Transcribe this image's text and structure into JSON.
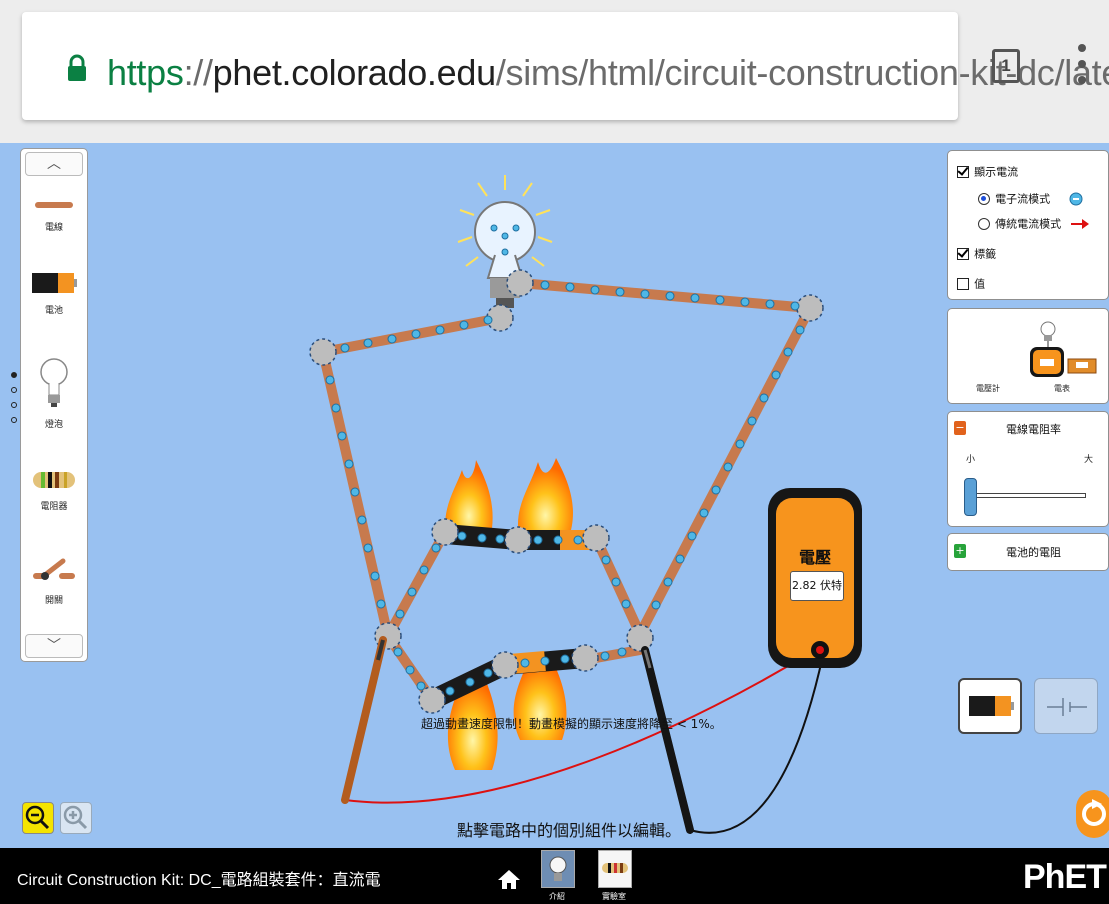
{
  "browser": {
    "url_scheme": "https",
    "url_sep": "://",
    "url_host": "phet.colorado.edu",
    "url_path": "/sims/html/circuit-construction-kit-dc/latest",
    "tab_count": "1"
  },
  "toolbox": {
    "items": [
      {
        "label": "電線",
        "icon": "wire-icon"
      },
      {
        "label": "電池",
        "icon": "battery-icon"
      },
      {
        "label": "燈泡",
        "icon": "lightbulb-icon"
      },
      {
        "label": "電阻器",
        "icon": "resistor-icon"
      },
      {
        "label": "開關",
        "icon": "switch-icon"
      }
    ]
  },
  "display_panel": {
    "show_current": "顯示電流",
    "electrons": "電子流模式",
    "conventional": "傳統電流模式",
    "labels": "標籤",
    "values": "值",
    "show_current_checked": true,
    "electrons_selected": true,
    "labels_checked": true,
    "values_checked": false
  },
  "tools_panel": {
    "voltmeter": "電壓計",
    "ammeter": "電表"
  },
  "wire_resistivity": {
    "title": "電線電阻率",
    "min": "小",
    "max": "大",
    "level": 0.0
  },
  "battery_resistance": {
    "title": "電池的電阻"
  },
  "voltmeter": {
    "title": "電壓",
    "reading": "2.82 伏特"
  },
  "messages": {
    "speed_warning": "超過動畫速度限制！動畫模擬的顯示速度將降至 < 1%。",
    "hint": "點擊電路中的個別組件以編輯。"
  },
  "footer": {
    "title": "Circuit Construction Kit: DC_電路組裝套件：直流電",
    "screens": [
      {
        "label": "介紹"
      },
      {
        "label": "實驗室"
      }
    ],
    "brand": "PhET"
  },
  "colors": {
    "electron": "#4fb7e6",
    "wire": "#c77a4e",
    "meter_orange": "#f7941d",
    "url_green": "#0b8043"
  }
}
